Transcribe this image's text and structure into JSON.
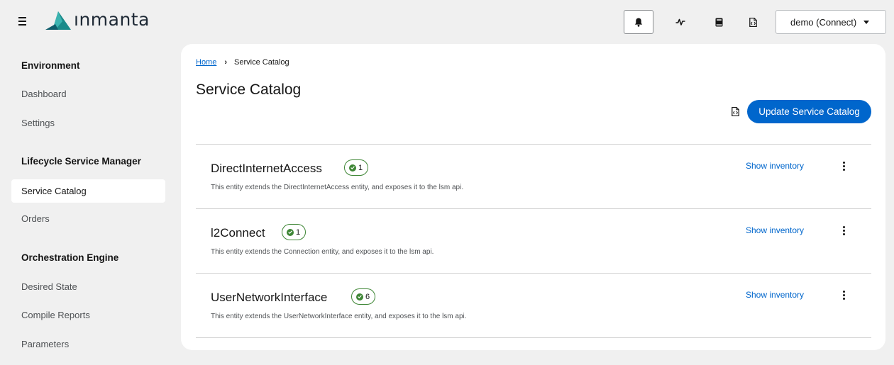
{
  "header": {
    "logo_text": "ınmanta",
    "environment_select": "demo (Connect)",
    "icons": [
      "menu-icon",
      "bell-icon",
      "activity-icon",
      "book-icon",
      "file-code-icon"
    ]
  },
  "sidebar": {
    "groups": [
      {
        "title": "Environment",
        "items": [
          "Dashboard",
          "Settings"
        ]
      },
      {
        "title": "Lifecycle Service Manager",
        "items": [
          "Service Catalog",
          "Orders"
        ]
      },
      {
        "title": "Orchestration Engine",
        "items": [
          "Desired State",
          "Compile Reports",
          "Parameters"
        ]
      }
    ],
    "active_item": "Service Catalog"
  },
  "main": {
    "breadcrumb": {
      "home": "Home",
      "current": "Service Catalog"
    },
    "title": "Service Catalog",
    "update_button": "Update Service Catalog",
    "entities": [
      {
        "name": "DirectInternetAccess",
        "count": "1",
        "description": "This entity extends the DirectInternetAccess entity, and exposes it to the lsm api.",
        "action": "Show inventory"
      },
      {
        "name": "l2Connect",
        "count": "1",
        "description": "This entity extends the Connection entity, and exposes it to the lsm api.",
        "action": "Show inventory"
      },
      {
        "name": "UserNetworkInterface",
        "count": "6",
        "description": "This entity extends the UserNetworkInterface entity, and exposes it to the lsm api.",
        "action": "Show inventory"
      }
    ]
  },
  "colors": {
    "accent": "#0066cc",
    "success": "#3e8635",
    "background": "#f0f0f0"
  }
}
